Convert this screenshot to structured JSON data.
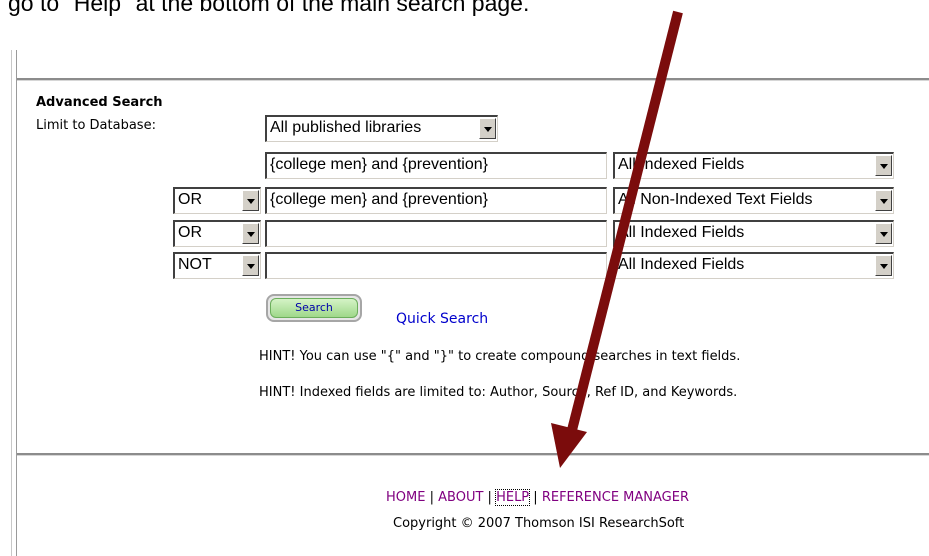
{
  "caption": "go to \"Help\" at the bottom of the main search page.",
  "search": {
    "title": "Advanced Search",
    "limit_label": "Limit to Database:",
    "database": "All published libraries",
    "rows": [
      {
        "operator": "",
        "query": "{college men} and {prevention}",
        "field": "All Indexed Fields"
      },
      {
        "operator": "OR",
        "query": "{college men} and {prevention}",
        "field": "All Non-Indexed Text Fields"
      },
      {
        "operator": "OR",
        "query": "",
        "field": "All Indexed Fields"
      },
      {
        "operator": "NOT",
        "query": "",
        "field": "All Indexed Fields"
      }
    ],
    "search_button": "Search",
    "quick_search": "Quick Search",
    "hint1": "HINT! You can use \"{\" and \"}\" to create compound searches in text fields.",
    "hint2": "HINT! Indexed fields are limited to: Author, Source, Ref ID, and Keywords."
  },
  "footer": {
    "home": "HOME",
    "about": "ABOUT",
    "help": "HELP",
    "reference_manager": "REFERENCE MANAGER",
    "separator": "|",
    "copyright": "Copyright © 2007 Thomson ISI ResearchSoft"
  },
  "colors": {
    "arrow": "#7b0c0c",
    "link": "#800080",
    "quick_search_link": "#0000cc"
  }
}
